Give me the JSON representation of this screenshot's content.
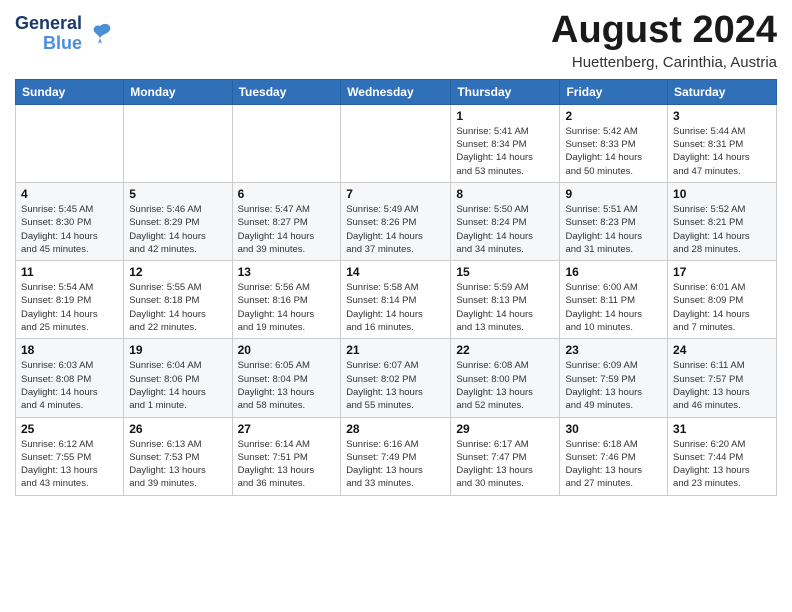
{
  "header": {
    "logo_line1": "General",
    "logo_line2": "Blue",
    "month_title": "August 2024",
    "subtitle": "Huettenberg, Carinthia, Austria"
  },
  "weekdays": [
    "Sunday",
    "Monday",
    "Tuesday",
    "Wednesday",
    "Thursday",
    "Friday",
    "Saturday"
  ],
  "weeks": [
    [
      {
        "day": "",
        "info": ""
      },
      {
        "day": "",
        "info": ""
      },
      {
        "day": "",
        "info": ""
      },
      {
        "day": "",
        "info": ""
      },
      {
        "day": "1",
        "info": "Sunrise: 5:41 AM\nSunset: 8:34 PM\nDaylight: 14 hours\nand 53 minutes."
      },
      {
        "day": "2",
        "info": "Sunrise: 5:42 AM\nSunset: 8:33 PM\nDaylight: 14 hours\nand 50 minutes."
      },
      {
        "day": "3",
        "info": "Sunrise: 5:44 AM\nSunset: 8:31 PM\nDaylight: 14 hours\nand 47 minutes."
      }
    ],
    [
      {
        "day": "4",
        "info": "Sunrise: 5:45 AM\nSunset: 8:30 PM\nDaylight: 14 hours\nand 45 minutes."
      },
      {
        "day": "5",
        "info": "Sunrise: 5:46 AM\nSunset: 8:29 PM\nDaylight: 14 hours\nand 42 minutes."
      },
      {
        "day": "6",
        "info": "Sunrise: 5:47 AM\nSunset: 8:27 PM\nDaylight: 14 hours\nand 39 minutes."
      },
      {
        "day": "7",
        "info": "Sunrise: 5:49 AM\nSunset: 8:26 PM\nDaylight: 14 hours\nand 37 minutes."
      },
      {
        "day": "8",
        "info": "Sunrise: 5:50 AM\nSunset: 8:24 PM\nDaylight: 14 hours\nand 34 minutes."
      },
      {
        "day": "9",
        "info": "Sunrise: 5:51 AM\nSunset: 8:23 PM\nDaylight: 14 hours\nand 31 minutes."
      },
      {
        "day": "10",
        "info": "Sunrise: 5:52 AM\nSunset: 8:21 PM\nDaylight: 14 hours\nand 28 minutes."
      }
    ],
    [
      {
        "day": "11",
        "info": "Sunrise: 5:54 AM\nSunset: 8:19 PM\nDaylight: 14 hours\nand 25 minutes."
      },
      {
        "day": "12",
        "info": "Sunrise: 5:55 AM\nSunset: 8:18 PM\nDaylight: 14 hours\nand 22 minutes."
      },
      {
        "day": "13",
        "info": "Sunrise: 5:56 AM\nSunset: 8:16 PM\nDaylight: 14 hours\nand 19 minutes."
      },
      {
        "day": "14",
        "info": "Sunrise: 5:58 AM\nSunset: 8:14 PM\nDaylight: 14 hours\nand 16 minutes."
      },
      {
        "day": "15",
        "info": "Sunrise: 5:59 AM\nSunset: 8:13 PM\nDaylight: 14 hours\nand 13 minutes."
      },
      {
        "day": "16",
        "info": "Sunrise: 6:00 AM\nSunset: 8:11 PM\nDaylight: 14 hours\nand 10 minutes."
      },
      {
        "day": "17",
        "info": "Sunrise: 6:01 AM\nSunset: 8:09 PM\nDaylight: 14 hours\nand 7 minutes."
      }
    ],
    [
      {
        "day": "18",
        "info": "Sunrise: 6:03 AM\nSunset: 8:08 PM\nDaylight: 14 hours\nand 4 minutes."
      },
      {
        "day": "19",
        "info": "Sunrise: 6:04 AM\nSunset: 8:06 PM\nDaylight: 14 hours\nand 1 minute."
      },
      {
        "day": "20",
        "info": "Sunrise: 6:05 AM\nSunset: 8:04 PM\nDaylight: 13 hours\nand 58 minutes."
      },
      {
        "day": "21",
        "info": "Sunrise: 6:07 AM\nSunset: 8:02 PM\nDaylight: 13 hours\nand 55 minutes."
      },
      {
        "day": "22",
        "info": "Sunrise: 6:08 AM\nSunset: 8:00 PM\nDaylight: 13 hours\nand 52 minutes."
      },
      {
        "day": "23",
        "info": "Sunrise: 6:09 AM\nSunset: 7:59 PM\nDaylight: 13 hours\nand 49 minutes."
      },
      {
        "day": "24",
        "info": "Sunrise: 6:11 AM\nSunset: 7:57 PM\nDaylight: 13 hours\nand 46 minutes."
      }
    ],
    [
      {
        "day": "25",
        "info": "Sunrise: 6:12 AM\nSunset: 7:55 PM\nDaylight: 13 hours\nand 43 minutes."
      },
      {
        "day": "26",
        "info": "Sunrise: 6:13 AM\nSunset: 7:53 PM\nDaylight: 13 hours\nand 39 minutes."
      },
      {
        "day": "27",
        "info": "Sunrise: 6:14 AM\nSunset: 7:51 PM\nDaylight: 13 hours\nand 36 minutes."
      },
      {
        "day": "28",
        "info": "Sunrise: 6:16 AM\nSunset: 7:49 PM\nDaylight: 13 hours\nand 33 minutes."
      },
      {
        "day": "29",
        "info": "Sunrise: 6:17 AM\nSunset: 7:47 PM\nDaylight: 13 hours\nand 30 minutes."
      },
      {
        "day": "30",
        "info": "Sunrise: 6:18 AM\nSunset: 7:46 PM\nDaylight: 13 hours\nand 27 minutes."
      },
      {
        "day": "31",
        "info": "Sunrise: 6:20 AM\nSunset: 7:44 PM\nDaylight: 13 hours\nand 23 minutes."
      }
    ]
  ]
}
